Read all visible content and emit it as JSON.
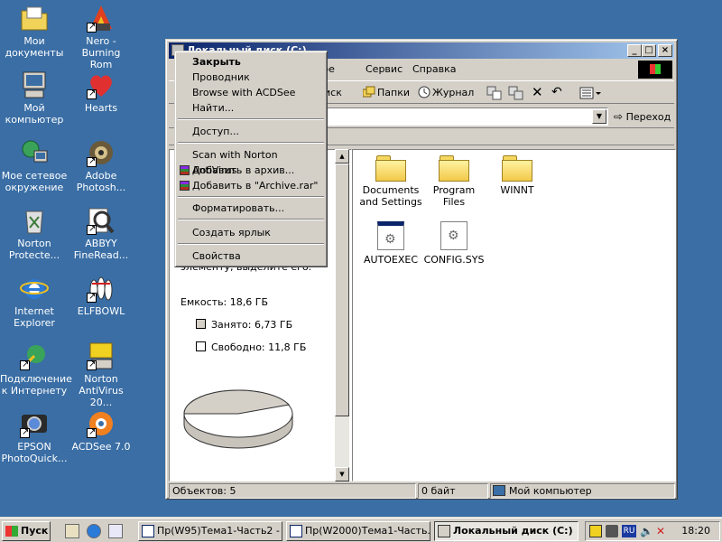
{
  "desktop": {
    "icons": [
      {
        "label": "Мои\nдокументы",
        "icon": "my-documents-icon"
      },
      {
        "label": "Nero - Burning\nRom",
        "icon": "nero-icon"
      },
      {
        "label": "Мой\nкомпьютер",
        "icon": "my-computer-icon"
      },
      {
        "label": "Hearts",
        "icon": "hearts-icon"
      },
      {
        "label": "Мое сетевое\nокружение",
        "icon": "network-icon"
      },
      {
        "label": "Adobe\nPhotosh...",
        "icon": "photoshop-icon"
      },
      {
        "label": "Norton\nProtecte...",
        "icon": "recycle-bin-icon"
      },
      {
        "label": "ABBYY\nFineRead...",
        "icon": "finereader-icon"
      },
      {
        "label": "Internet\nExplorer",
        "icon": "ie-icon"
      },
      {
        "label": "ELFBOWL",
        "icon": "elfbowl-icon"
      },
      {
        "label": "Подключение\nк Интернету",
        "icon": "connect-icon"
      },
      {
        "label": "Norton\nAntiVirus 20...",
        "icon": "norton-icon"
      },
      {
        "label": "EPSON\nPhotoQuick...",
        "icon": "epson-icon"
      },
      {
        "label": "ACDSee 7.0",
        "icon": "acdsee-icon"
      }
    ]
  },
  "window": {
    "title": "Локальный диск (C:)",
    "buttons": {
      "minimize": "_",
      "maximize": "□",
      "close": "×"
    },
    "menu": [
      "нное",
      "Сервис",
      "Справка"
    ],
    "toolbar": {
      "search": "иск",
      "folders": "Папки",
      "history": "Журнал"
    },
    "address": {
      "go": "Переход",
      "value": ""
    },
    "left_pane": {
      "partial_text": "элементу, выделите его.",
      "capacity": "Емкость: 18,6 ГБ",
      "used": "Занято: 6,73 ГБ",
      "free": "Свободно: 11,8 ГБ"
    },
    "files": [
      {
        "name": "Documents\nand Settings",
        "type": "folder"
      },
      {
        "name": "Program Files",
        "type": "folder"
      },
      {
        "name": "WINNT",
        "type": "folder"
      },
      {
        "name": "AUTOEXEC",
        "type": "file"
      },
      {
        "name": "CONFIG.SYS",
        "type": "file"
      }
    ],
    "status": {
      "objects": "Объектов: 5",
      "size": "0 байт",
      "location": "Мой компьютер"
    }
  },
  "context_menu": {
    "items": [
      {
        "label": "Закрыть",
        "bold": true
      },
      {
        "label": "Проводник"
      },
      {
        "label": "Browse with ACDSee"
      },
      {
        "label": "Найти..."
      },
      {
        "label": "Доступ..."
      },
      {
        "label": "Scan with Norton AntiVirus"
      },
      {
        "label": "Добавить в архив...",
        "icon": "winrar-icon"
      },
      {
        "label": "Добавить в \"Archive.rar\"",
        "icon": "winrar-icon"
      },
      {
        "label": "Форматировать..."
      },
      {
        "label": "Создать ярлык"
      },
      {
        "label": "Свойства"
      }
    ]
  },
  "taskbar": {
    "start": "Пуск",
    "tasks": [
      {
        "label": "Пр(W95)Тема1-Часть2 - ..."
      },
      {
        "label": "Пр(W2000)Тема1-Часть..."
      },
      {
        "label": "Локальный диск (C:)",
        "active": true
      }
    ],
    "tray": {
      "lang": "RU",
      "clock": "18:20"
    }
  },
  "colors": {
    "desktop": "#3a6ea5",
    "titlebar_start": "#0a246a",
    "titlebar_end": "#a6caf0",
    "face": "#d4d0c8"
  }
}
